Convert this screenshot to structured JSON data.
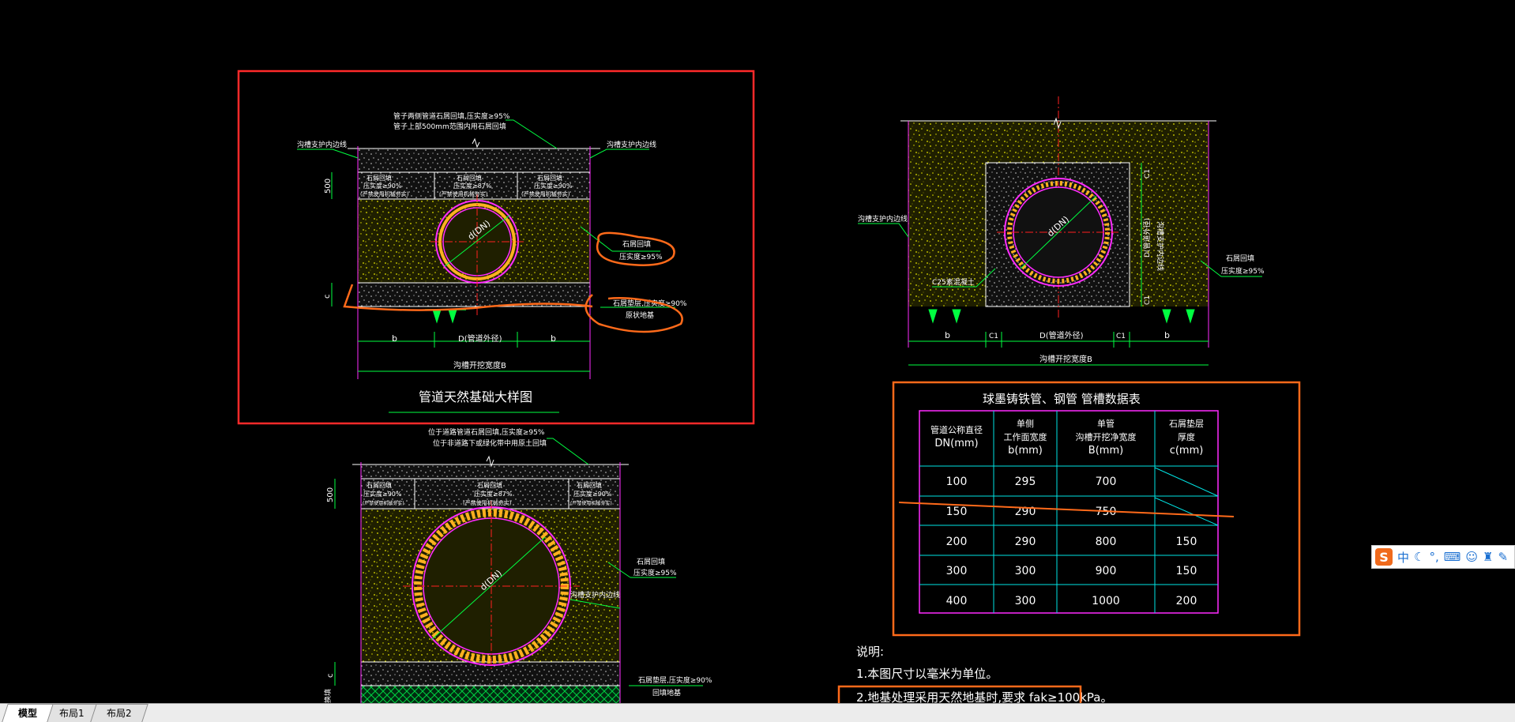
{
  "detail1": {
    "title": "管道天然基础大样图",
    "note_top_1": "管子两侧管道石屑回填,压实度≥95%",
    "note_top_2": "管子上部500mm范围内用石屑回填",
    "trench_left": "沟槽支护内边线",
    "trench_right": "沟槽支护内边线",
    "dim_500": "500",
    "dim_c": "c",
    "box_line1": "石屑回填",
    "box_line2_side": "压实度≥90%",
    "box_line2_mid": "压实度≥87%",
    "box_line3": "(严禁使用机械夯实)",
    "pipe_label": "d(DN)",
    "fill_note_1": "石屑回填",
    "fill_note_2": "压实度≥95%",
    "bed_note_1": "石屑垫层,压实度≥90%",
    "bed_note_2": "原状地基",
    "dim_b_left": "b",
    "dim_d": "D(管道外径)",
    "dim_b_right": "b",
    "dim_total": "沟槽开挖宽度B"
  },
  "detail2": {
    "trench_left": "沟槽支护内边线",
    "trench_right": "沟槽支护内边线",
    "fill_note_1": "石屑回填",
    "fill_note_2": "压实度≥95%",
    "concrete": "C25素混凝土",
    "dim_c1_top": "C1",
    "dim_c1_bottom": "C1",
    "dim_dx": "D(管道外径)",
    "pipe_label": "d(DN)",
    "dim_b_left": "b",
    "dim_c1_left": "C1",
    "dim_d": "D(管道外径)",
    "dim_c1_right": "C1",
    "dim_b_right": "b",
    "dim_total": "沟槽开挖宽度B"
  },
  "detail3": {
    "note_top_1": "位于道路管道石屑回填,压实度≥95%",
    "note_top_2": "位于非道路下或绿化带中用原土回填",
    "dim_500": "500",
    "dim_c": "c",
    "box_line1": "石屑回填",
    "box_line2_side": "压实度≥90%",
    "box_line2_mid": "压实度≥87%",
    "box_line3": "(严禁使用机械夯实)",
    "pipe_label": "d(DN)",
    "fill_note_1": "石屑回填",
    "fill_note_2": "压实度≥95%",
    "trench_inner": "沟槽支护内边线",
    "bed_note_1": "石屑垫层,压实度≥90%",
    "bed_note_2": "回填地基",
    "side_label": "换填"
  },
  "table": {
    "title": "球墨铸铁管、钢管 管槽数据表",
    "headers": [
      [
        "管道公称直径",
        "DN(mm)"
      ],
      [
        "单侧",
        "工作面宽度",
        "b(mm)"
      ],
      [
        "单管",
        "沟槽开挖净宽度",
        "B(mm)"
      ],
      [
        "石屑垫层",
        "厚度",
        "c(mm)"
      ]
    ],
    "rows": [
      [
        "100",
        "295",
        "700",
        ""
      ],
      [
        "150",
        "290",
        "750",
        ""
      ],
      [
        "200",
        "290",
        "800",
        "150"
      ],
      [
        "300",
        "300",
        "900",
        "150"
      ],
      [
        "400",
        "300",
        "1000",
        "200"
      ]
    ]
  },
  "notes": {
    "heading": "说明:",
    "item1": "1.本图尺寸以毫米为单位。",
    "item2": "2.地基处理采用天然地基时,要求 fak≥100kPa。"
  },
  "layout_tabs": [
    "模型",
    "布局1",
    "布局2"
  ],
  "ime": {
    "logo": "S",
    "lang": "中",
    "icons": [
      "moon-icon",
      "punctuation-icon",
      "keyboard-icon",
      "user-icon",
      "shirt-icon",
      "wrench-icon"
    ]
  },
  "colors": {
    "background": "#000000",
    "annotation_red": "#ff3b2f",
    "annotation_orange": "#ff6a1a",
    "cad_magenta": "#ff2bff",
    "cad_cyan": "#00e5e5",
    "cad_green": "#00ff40",
    "cad_yellow": "#ffff00"
  }
}
